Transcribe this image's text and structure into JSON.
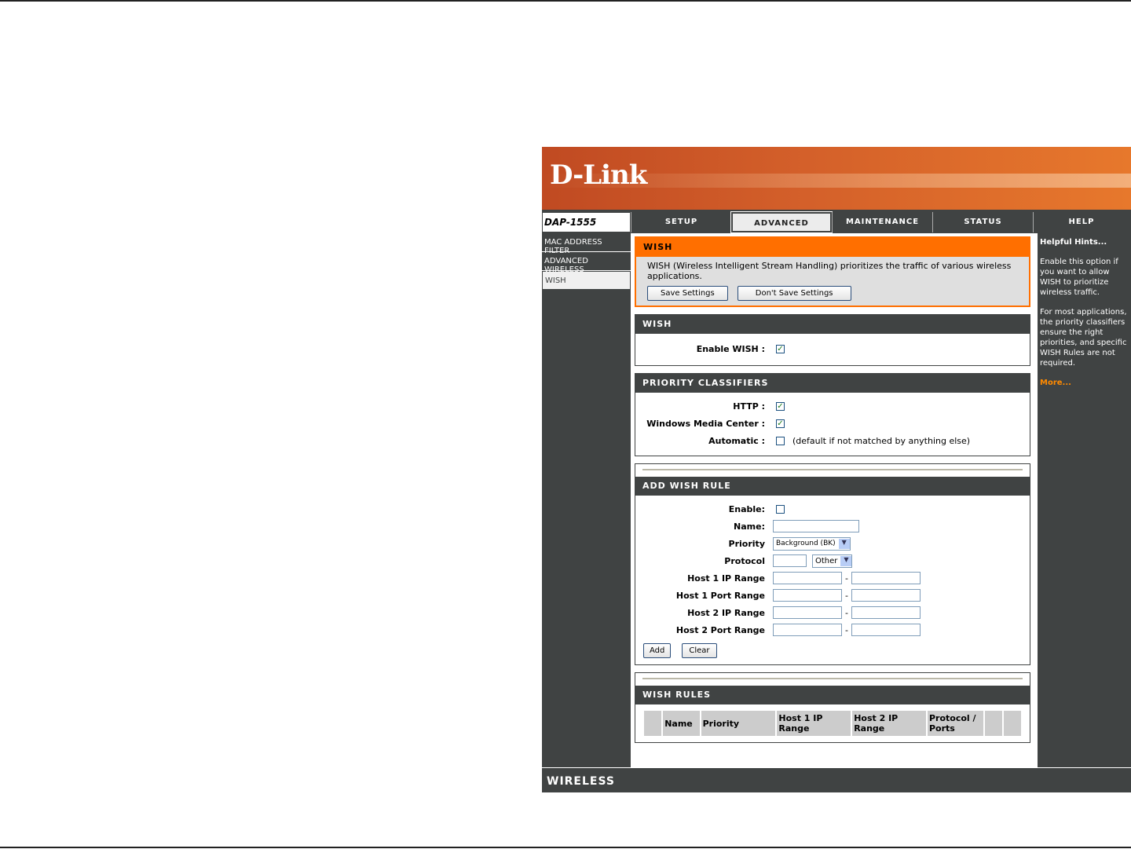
{
  "brand": {
    "logo": "D-Link",
    "model": "DAP-1555",
    "footer": "WIRELESS"
  },
  "nav": {
    "tabs": [
      "SETUP",
      "ADVANCED",
      "MAINTENANCE",
      "STATUS",
      "HELP"
    ],
    "active": "ADVANCED"
  },
  "sidebar": {
    "items": [
      "MAC ADDRESS FILTER",
      "ADVANCED WIRELESS",
      "WISH"
    ],
    "active": "WISH"
  },
  "intro": {
    "title": "WISH",
    "text": "WISH (Wireless Intelligent Stream Handling) prioritizes the traffic of various wireless applications.",
    "save": "Save Settings",
    "dont_save": "Don't Save Settings"
  },
  "wish": {
    "title": "WISH",
    "enable_label": "Enable WISH :",
    "enabled": true
  },
  "classifiers": {
    "title": "PRIORITY CLASSIFIERS",
    "http": "HTTP :",
    "wmc": "Windows Media Center :",
    "automatic": "Automatic :",
    "automatic_note": "(default if not matched by anything else)",
    "http_checked": true,
    "wmc_checked": true,
    "automatic_checked": false
  },
  "add_rule": {
    "title": "ADD WISH RULE",
    "enable": "Enable:",
    "name": "Name:",
    "priority": "Priority",
    "priority_value": "Background (BK)",
    "protocol": "Protocol",
    "protocol_value": "Other",
    "host1_ip": "Host 1 IP Range",
    "host1_port": "Host 1 Port Range",
    "host2_ip": "Host 2 IP Range",
    "host2_port": "Host 2 Port Range",
    "dash": "-",
    "add": "Add",
    "clear": "Clear"
  },
  "rules": {
    "title": "WISH RULES",
    "columns": [
      "",
      "Name",
      "Priority",
      "Host 1 IP Range",
      "Host 2 IP Range",
      "Protocol / Ports",
      "",
      ""
    ]
  },
  "help": {
    "title": "Helpful Hints...",
    "p1": "Enable this option if you want to allow WISH to prioritize wireless traffic.",
    "p2": "For most applications, the priority classifiers ensure the right priorities, and specific WISH Rules are not required.",
    "more": "More..."
  },
  "colors": {
    "accent": "#ff6f00",
    "dark": "#404343"
  }
}
